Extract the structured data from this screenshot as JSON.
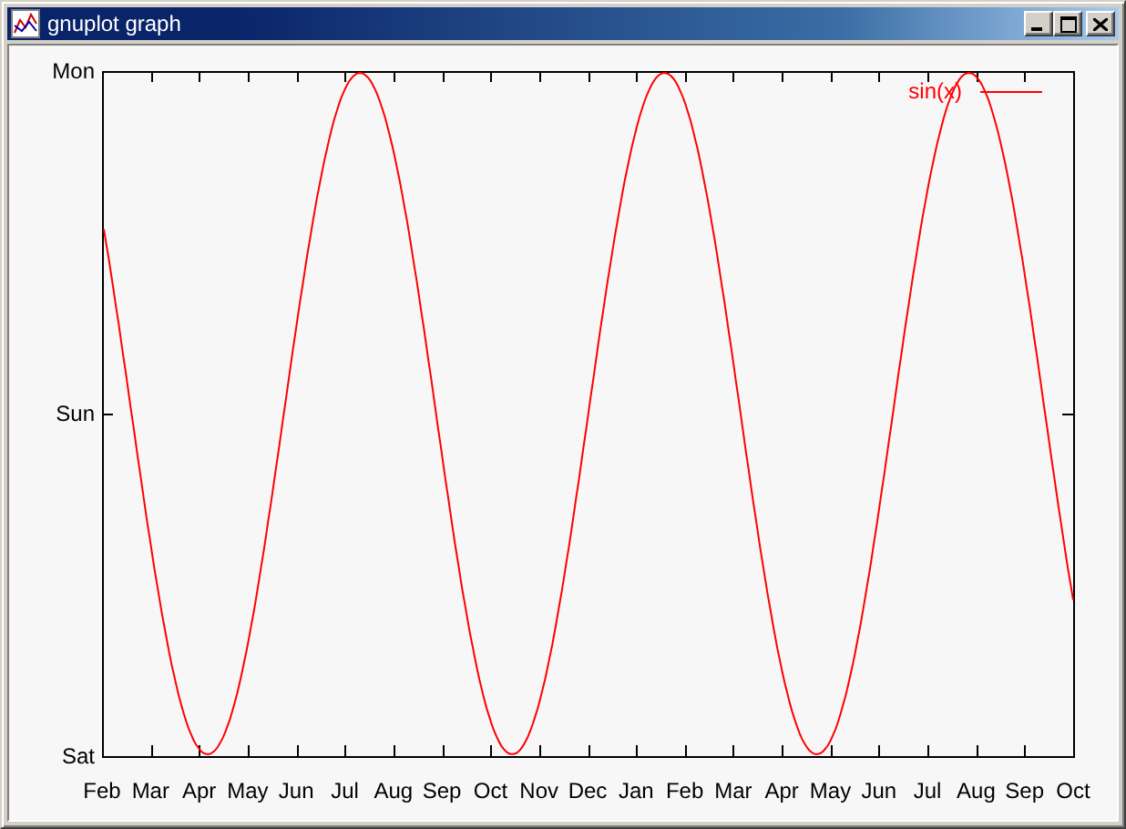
{
  "window": {
    "title": "gnuplot graph"
  },
  "plot": {
    "y_labels": [
      "Mon",
      "Sun",
      "Sat"
    ],
    "x_labels": [
      "Feb",
      "Mar",
      "Apr",
      "May",
      "Jun",
      "Jul",
      "Aug",
      "Sep",
      "Oct",
      "Nov",
      "Dec",
      "Jan",
      "Feb",
      "Mar",
      "Apr",
      "May",
      "Jun",
      "Jul",
      "Aug",
      "Sep",
      "Oct"
    ],
    "legend": [
      {
        "label": "sin(x)",
        "color": "#ff0000"
      }
    ]
  }
}
